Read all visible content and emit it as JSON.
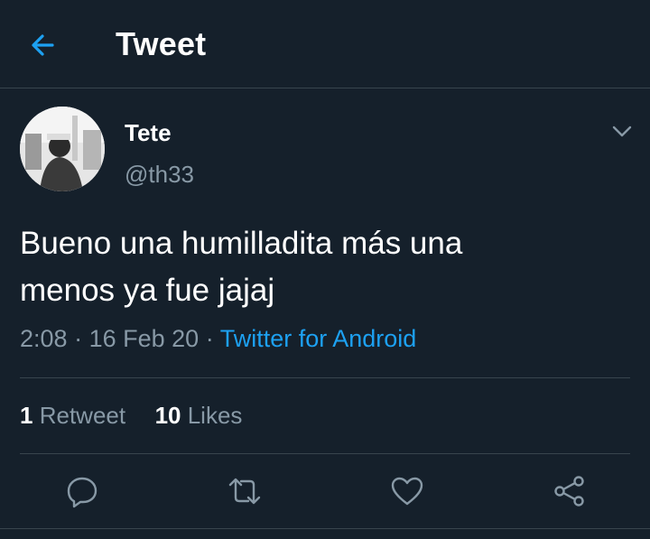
{
  "header": {
    "title": "Tweet",
    "back_icon": "arrow-left-icon",
    "accent_color": "#1da1f2"
  },
  "tweet": {
    "author_name": "Tete",
    "author_handle": "@th33",
    "text_line1": "Bueno una humilladita más una",
    "text_line2": "menos ya fue jajaj",
    "time": "2:08",
    "date": "16 Feb 20",
    "separator": "·",
    "source": "Twitter for Android"
  },
  "stats": {
    "retweets_count": "1",
    "retweets_label": "Retweet",
    "likes_count": "10",
    "likes_label": "Likes"
  },
  "actions": {
    "icons": [
      "reply-icon",
      "retweet-icon",
      "like-icon",
      "share-icon"
    ]
  },
  "colors": {
    "background": "#15202b",
    "secondary_text": "#8899a6",
    "divider": "#38444d"
  }
}
